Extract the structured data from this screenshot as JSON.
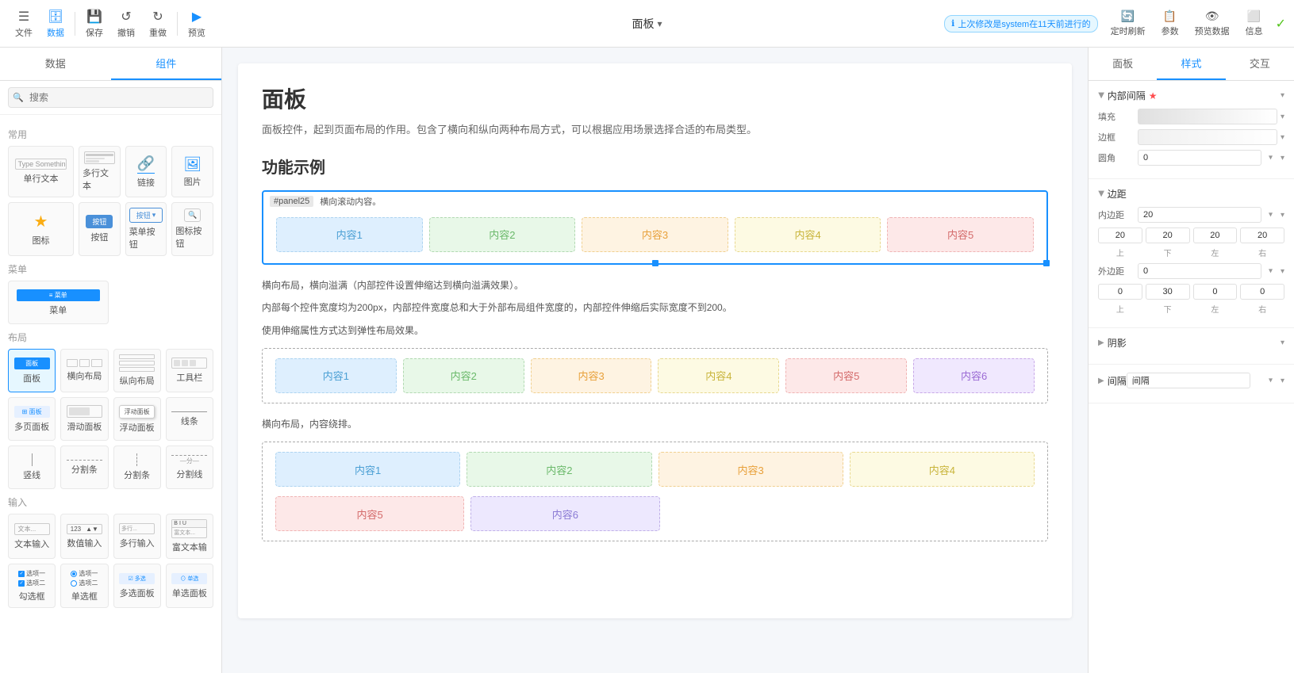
{
  "toolbar": {
    "title": "面板",
    "title_arrow": "▾",
    "left_buttons": [
      {
        "id": "file",
        "icon": "☰",
        "label": "文件"
      },
      {
        "id": "data",
        "icon": "🗄",
        "label": "数据"
      },
      {
        "id": "save",
        "icon": "💾",
        "label": "保存"
      },
      {
        "id": "undo",
        "icon": "↺",
        "label": "撤销"
      },
      {
        "id": "redo",
        "icon": "↻",
        "label": "重做"
      },
      {
        "id": "preview",
        "icon": "▶",
        "label": "预览"
      }
    ],
    "right_buttons": [
      {
        "id": "refresh",
        "icon": "🔄",
        "label": "定时刷新"
      },
      {
        "id": "params",
        "icon": "📋",
        "label": "参数"
      },
      {
        "id": "preview_data",
        "icon": "👁",
        "label": "预览数据"
      },
      {
        "id": "interact",
        "icon": "↔",
        "label": "信息"
      }
    ],
    "last_modified": "上次修改是system在11天前进行的",
    "check_icon": "✓"
  },
  "left_sidebar": {
    "tabs": [
      "数据",
      "组件"
    ],
    "active_tab": "组件",
    "search_placeholder": "搜索",
    "sections": {
      "common": {
        "title": "常用",
        "items": [
          {
            "id": "single-text",
            "label": "单行文本",
            "type": "text-preview"
          },
          {
            "id": "multi-text",
            "label": "多行文本",
            "type": "multi-text-preview"
          },
          {
            "id": "link",
            "label": "链接",
            "type": "link-preview"
          },
          {
            "id": "image",
            "label": "图片",
            "type": "image-preview"
          },
          {
            "id": "icon",
            "label": "图标",
            "type": "icon-preview"
          },
          {
            "id": "button",
            "label": "按钮",
            "type": "button-preview"
          },
          {
            "id": "menu-btn",
            "label": "菜单按钮",
            "type": "menu-btn-preview"
          },
          {
            "id": "icon-btn",
            "label": "图标按钮",
            "type": "icon-btn-preview"
          }
        ]
      },
      "menu": {
        "title": "菜单",
        "items": [
          {
            "id": "menu",
            "label": "菜单",
            "type": "menu-preview"
          }
        ]
      },
      "layout": {
        "title": "布局",
        "items": [
          {
            "id": "panel",
            "label": "面板",
            "type": "panel-preview",
            "active": true
          },
          {
            "id": "hbox",
            "label": "横向布局",
            "type": "hbox-preview"
          },
          {
            "id": "vbox",
            "label": "纵向布局",
            "type": "vbox-preview"
          },
          {
            "id": "toolbar-comp",
            "label": "工具栏",
            "type": "toolbar-preview"
          },
          {
            "id": "multipage",
            "label": "多页面板",
            "type": "multipage-preview"
          },
          {
            "id": "scroll",
            "label": "滑动面板",
            "type": "scroll-preview"
          },
          {
            "id": "float",
            "label": "浮动面板",
            "type": "float-preview"
          },
          {
            "id": "linebar",
            "label": "线条",
            "type": "line-preview"
          },
          {
            "id": "vline",
            "label": "竖线",
            "type": "vline-preview"
          },
          {
            "id": "divider-h",
            "label": "分割条",
            "type": "divider-h-preview"
          },
          {
            "id": "divider-v",
            "label": "分割条",
            "type": "divider-v-preview"
          },
          {
            "id": "divider-text",
            "label": "分割线",
            "type": "divider-text-preview"
          }
        ]
      },
      "input": {
        "title": "输入",
        "items": [
          {
            "id": "text-input",
            "label": "文本输入",
            "type": "text-input-preview"
          },
          {
            "id": "number-input",
            "label": "数值输入",
            "type": "number-input-preview"
          },
          {
            "id": "multi-input",
            "label": "多行输入",
            "type": "multi-input-preview"
          },
          {
            "id": "rich-text",
            "label": "富文本输",
            "type": "rich-text-preview"
          },
          {
            "id": "checkbox",
            "label": "勾选框",
            "type": "checkbox-preview"
          },
          {
            "id": "radio",
            "label": "单选框",
            "type": "radio-preview"
          },
          {
            "id": "multi-checkbox",
            "label": "多选面板",
            "type": "multi-checkbox-preview"
          },
          {
            "id": "single-radio",
            "label": "单选面板",
            "type": "single-radio-preview"
          }
        ]
      }
    }
  },
  "canvas": {
    "page_title": "面板",
    "page_desc": "面板控件，起到页面布局的作用。包含了横向和纵向两种布局方式，可以根据应用场景选择合适的布局类型。",
    "section_title": "功能示例",
    "panel_hint": "横向滚动内容。",
    "panel_label": "#panel25",
    "demos": [
      {
        "id": "demo1",
        "type": "selected",
        "items": [
          "内容1",
          "内容2",
          "内容3",
          "内容4",
          "内容5"
        ],
        "colors": [
          "blue",
          "green",
          "orange",
          "yellow",
          "pink"
        ]
      },
      {
        "id": "demo1-desc",
        "lines": [
          "横向布局，横向溢满（内部控件设置伸缩达到横向溢满效果）。",
          "内部每个控件宽度均为200px，内部控件宽度总和大于外部布局组件宽度的，内部控件伸缩后实际宽度不到200。",
          "使用伸缩属性方式达到弹性布局效果。"
        ]
      },
      {
        "id": "demo2",
        "type": "normal",
        "items": [
          "内容1",
          "内容2",
          "内容3",
          "内容4",
          "内容5",
          "内容6"
        ],
        "colors": [
          "blue",
          "green",
          "orange",
          "yellow",
          "pink",
          "purple"
        ]
      },
      {
        "id": "demo2-desc",
        "lines": [
          "横向布局，内容绕排。"
        ]
      },
      {
        "id": "demo3",
        "type": "normal-wrap",
        "row1": {
          "items": [
            "内容1",
            "内容2",
            "内容3",
            "内容4"
          ],
          "colors": [
            "blue",
            "green",
            "orange",
            "yellow"
          ]
        },
        "row2": {
          "items": [
            "内容5",
            "内容6"
          ],
          "colors": [
            "pink",
            "lavender"
          ]
        }
      }
    ]
  },
  "right_sidebar": {
    "tabs": [
      "面板",
      "样式",
      "交互"
    ],
    "active_tab": "样式",
    "sections": {
      "inner_padding": {
        "title": "内部间隔",
        "required": true,
        "fill_label": "填充",
        "fill_gradient": true,
        "border_label": "边框",
        "corner_label": "圆角",
        "corner_value": "0"
      },
      "margin": {
        "title": "边距",
        "inner_label": "内边距",
        "inner_value": "20",
        "inner_top": "20",
        "inner_bottom": "20",
        "inner_left": "20",
        "inner_right": "20",
        "outer_label": "外边距",
        "outer_value": "0",
        "outer_top": "0",
        "outer_bottom": "30",
        "outer_left": "0",
        "outer_right": "0"
      },
      "shadow": {
        "title": "阴影"
      },
      "spacing": {
        "title": "间隔",
        "value": "间隔"
      }
    }
  }
}
